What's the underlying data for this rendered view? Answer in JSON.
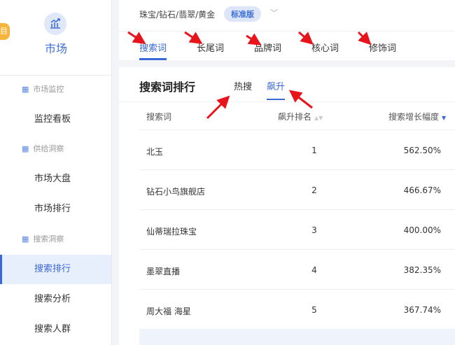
{
  "sidebar": {
    "badge": "目",
    "module": "市场",
    "items": [
      {
        "label": "市场监控",
        "type": "section"
      },
      {
        "label": "监控看板",
        "type": "item"
      },
      {
        "label": "供给洞察",
        "type": "section"
      },
      {
        "label": "市场大盘",
        "type": "item"
      },
      {
        "label": "市场排行",
        "type": "item"
      },
      {
        "label": "搜索洞察",
        "type": "section"
      },
      {
        "label": "搜索排行",
        "type": "item",
        "active": true
      },
      {
        "label": "搜索分析",
        "type": "item"
      },
      {
        "label": "搜索人群",
        "type": "item"
      }
    ]
  },
  "header": {
    "category": "珠宝/钻石/翡翠/黄金",
    "edition": "标准版",
    "tabs": [
      "搜索词",
      "长尾词",
      "品牌词",
      "核心词",
      "修饰词"
    ]
  },
  "panel": {
    "title": "搜索词排行",
    "subtabs": [
      "热搜",
      "飙升"
    ],
    "columns": [
      "搜索词",
      "飙升排名",
      "搜索增长幅度"
    ],
    "rows": [
      [
        "北玉",
        "1",
        "562.50%"
      ],
      [
        "钻石小鸟旗舰店",
        "2",
        "466.67%"
      ],
      [
        "仙蒂瑞拉珠宝",
        "3",
        "400.00%"
      ],
      [
        "墨翠直播",
        "4",
        "382.35%"
      ],
      [
        "周大福 海星",
        "5",
        "367.74%"
      ]
    ]
  },
  "colors": {
    "accent": "#3a68d6",
    "arrow": "#e8141b"
  }
}
